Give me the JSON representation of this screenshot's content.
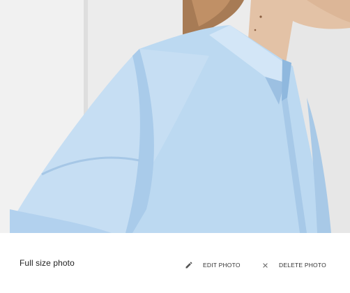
{
  "photo": {
    "subject": "person-in-light-blue-shirt",
    "colors": {
      "wall": "#ececec",
      "shirt": "#bcd9f1",
      "shirt_shadow": "#9fc3e4",
      "skin": "#e3c2a6",
      "hair": "#a77b55"
    }
  },
  "footer": {
    "caption": "Full size photo",
    "edit": {
      "label": "EDIT PHOTO",
      "icon": "pencil-icon"
    },
    "delete": {
      "label": "DELETE PHOTO",
      "icon": "close-icon"
    }
  }
}
